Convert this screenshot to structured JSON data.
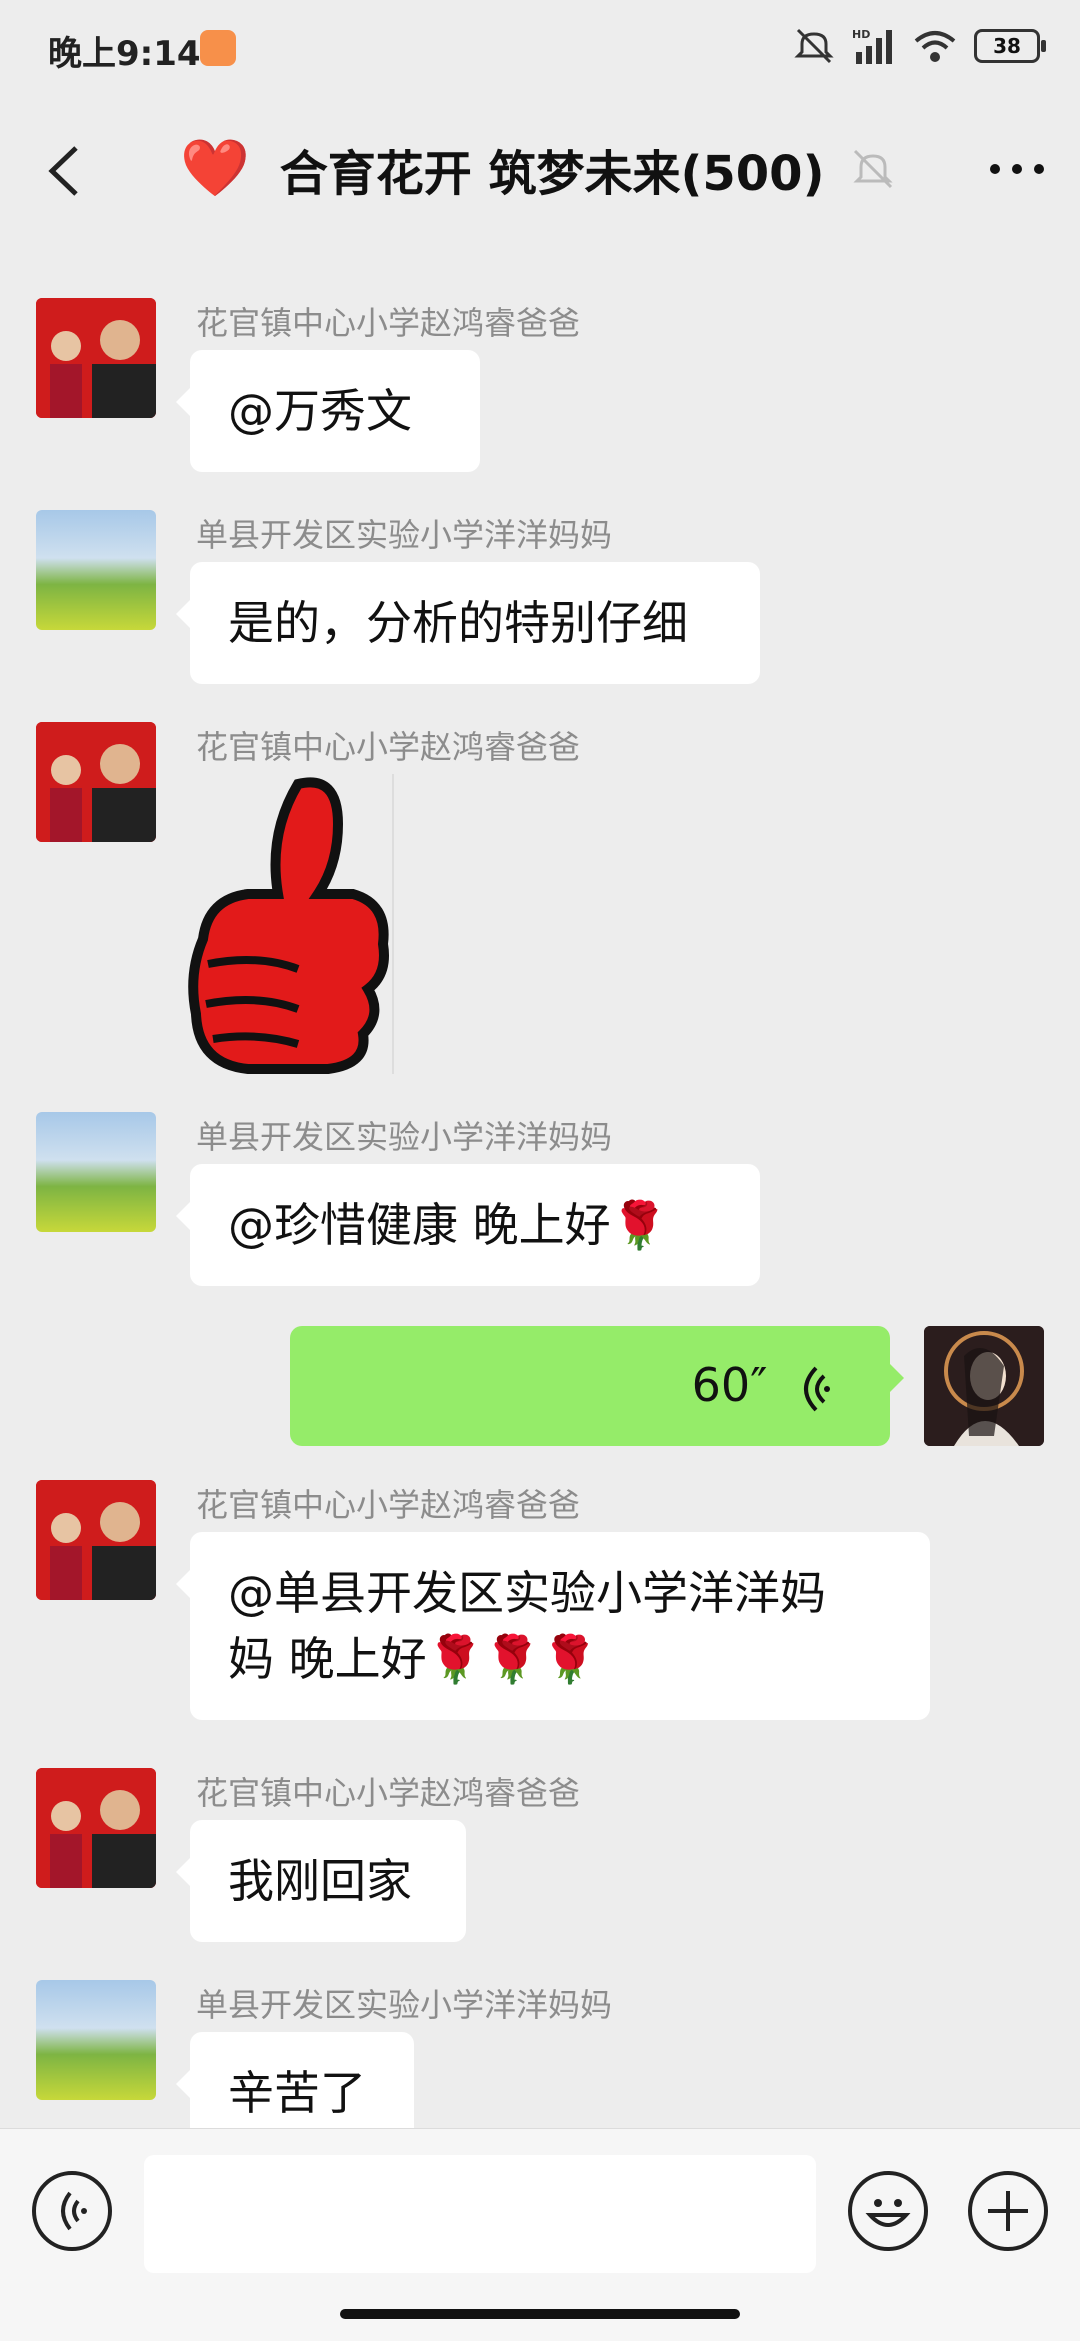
{
  "status_bar": {
    "time": "晚上9:14",
    "battery": "38",
    "network": "HD"
  },
  "header": {
    "title": "合育花开 筑梦未来(500)",
    "emoji": "❤️"
  },
  "messages": [
    {
      "sender": "花官镇中心小学赵鸿睿爸爸",
      "text": "@万秀文"
    },
    {
      "sender": "单县开发区实验小学洋洋妈妈",
      "text": "是的，分析的特别仔细"
    },
    {
      "sender": "花官镇中心小学赵鸿睿爸爸",
      "sticker": "thumbs-up"
    },
    {
      "sender": "单县开发区实验小学洋洋妈妈",
      "text": "@珍惜健康  晚上好🌹"
    },
    {
      "sender": "me",
      "voice_duration": "60″"
    },
    {
      "sender": "花官镇中心小学赵鸿睿爸爸",
      "line1": "@单县开发区实验小学洋洋妈",
      "line2": "妈  晚上好🌹🌹🌹"
    },
    {
      "sender": "花官镇中心小学赵鸿睿爸爸",
      "text": "我刚回家"
    },
    {
      "sender": "单县开发区实验小学洋洋妈妈",
      "text": "辛苦了"
    }
  ],
  "input": {
    "placeholder": ""
  },
  "colors": {
    "accent_green": "#95ec69",
    "heart": "#e0151d",
    "background": "#ededed"
  }
}
